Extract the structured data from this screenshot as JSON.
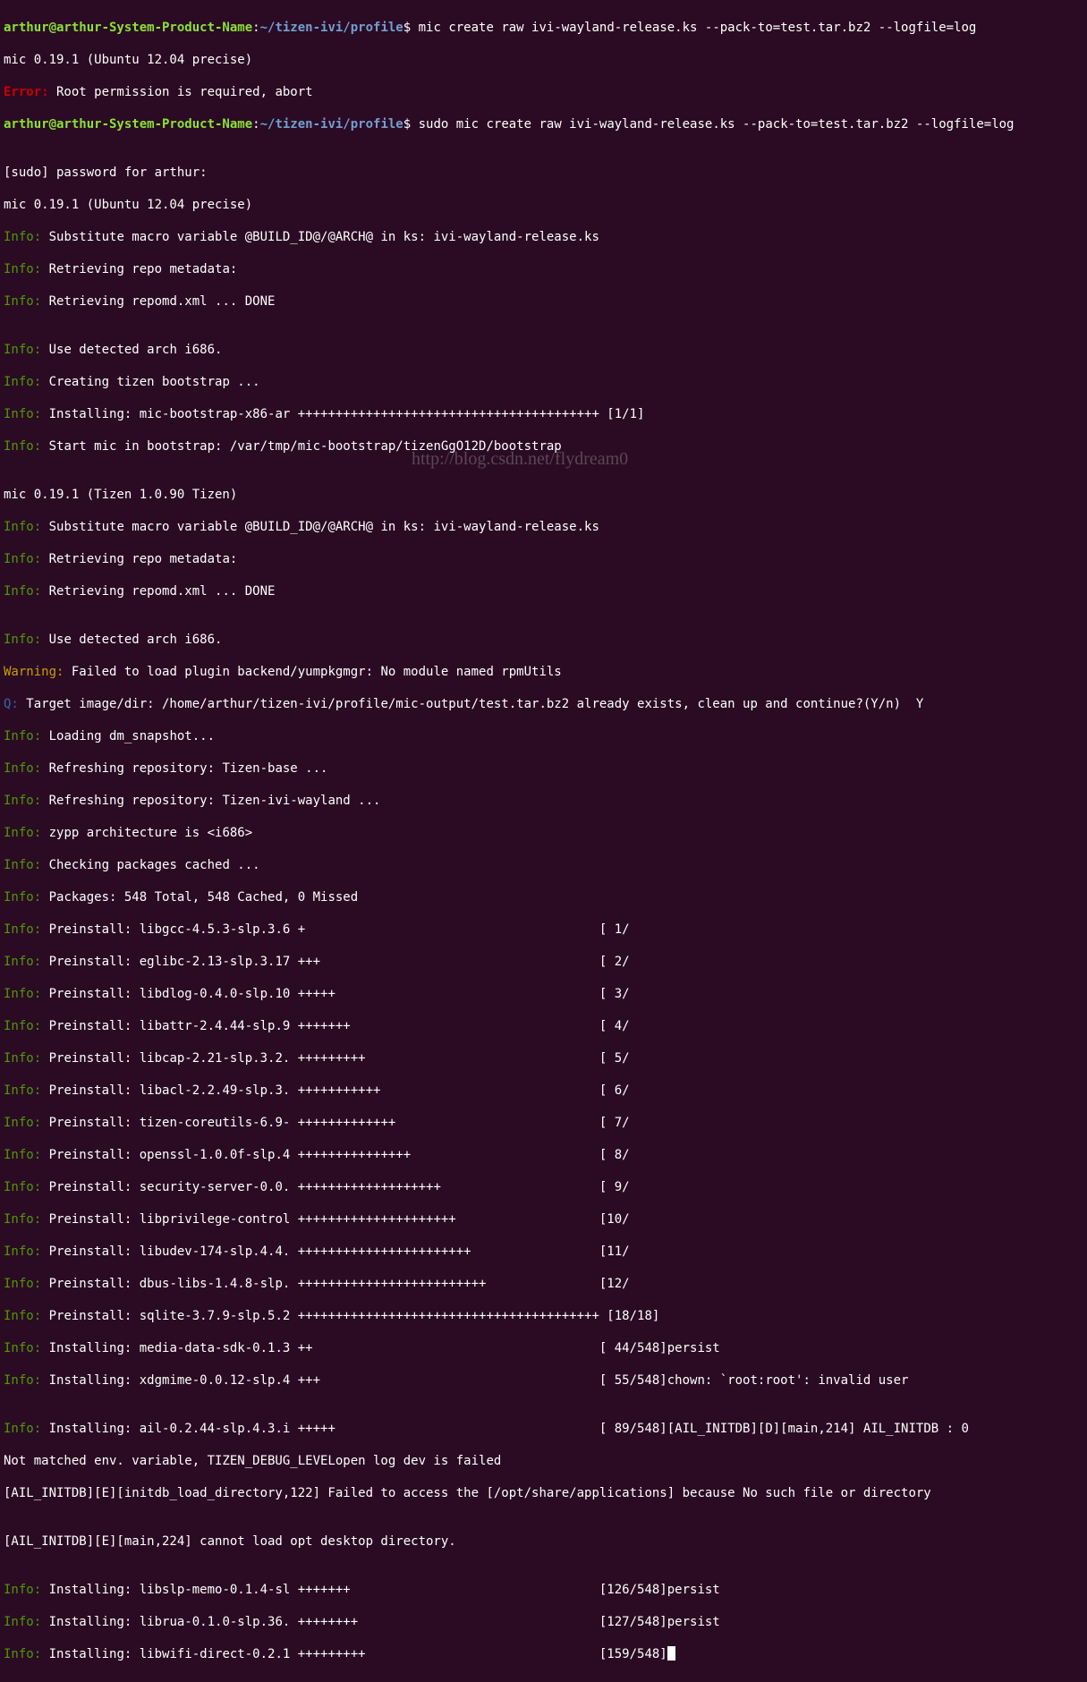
{
  "watermark": "http://blog.csdn.net/flydream0",
  "prompt1": {
    "userhost": "arthur@arthur-System-Product-Name",
    "colon": ":",
    "path": "~/tizen-ivi/profile",
    "dollar": "$ ",
    "cmd": "mic create raw ivi-wayland-release.ks --pack-to=test.tar.bz2 --logfile=log"
  },
  "line2": "mic 0.19.1 (Ubuntu 12.04 precise)",
  "line3": {
    "label": "Error:",
    "text": " Root permission is required, abort"
  },
  "prompt2": {
    "userhost": "arthur@arthur-System-Product-Name",
    "colon": ":",
    "path": "~/tizen-ivi/profile",
    "dollar": "$ ",
    "cmd": "sudo mic create raw ivi-wayland-release.ks --pack-to=test.tar.bz2 --logfile=log"
  },
  "blank1": "",
  "line5": "[sudo] password for arthur: ",
  "line6": "mic 0.19.1 (Ubuntu 12.04 precise)",
  "i1": {
    "label": "Info:",
    "text": " Substitute macro variable @BUILD_ID@/@ARCH@ in ks: ivi-wayland-release.ks"
  },
  "i2": {
    "label": "Info:",
    "text": " Retrieving repo metadata:"
  },
  "i3": {
    "label": "Info:",
    "text": " Retrieving repomd.xml ... DONE"
  },
  "blank2": "",
  "i4": {
    "label": "Info:",
    "text": " Use detected arch i686."
  },
  "i5": {
    "label": "Info:",
    "text": " Creating tizen bootstrap ..."
  },
  "i6": {
    "label": "Info:",
    "text": " Installing: mic-bootstrap-x86-ar ++++++++++++++++++++++++++++++++++++++++ [1/1]"
  },
  "i7": {
    "label": "Info:",
    "text": " Start mic in bootstrap: /var/tmp/mic-bootstrap/tizenGgO12D/bootstrap"
  },
  "blank3": "",
  "line_mic2": "mic 0.19.1 (Tizen 1.0.90 Tizen)",
  "i8": {
    "label": "Info:",
    "text": " Substitute macro variable @BUILD_ID@/@ARCH@ in ks: ivi-wayland-release.ks"
  },
  "i9": {
    "label": "Info:",
    "text": " Retrieving repo metadata:"
  },
  "i10": {
    "label": "Info:",
    "text": " Retrieving repomd.xml ... DONE"
  },
  "blank4": "",
  "i11": {
    "label": "Info:",
    "text": " Use detected arch i686."
  },
  "w1": {
    "label": "Warning:",
    "text": " Failed to load plugin backend/yumpkgmgr: No module named rpmUtils"
  },
  "q1": {
    "label": "Q:",
    "text": " Target image/dir: /home/arthur/tizen-ivi/profile/mic-output/test.tar.bz2 already exists, clean up and continue?(Y/n)  Y"
  },
  "i12": {
    "label": "Info:",
    "text": " Loading dm_snapshot..."
  },
  "i13": {
    "label": "Info:",
    "text": " Refreshing repository: Tizen-base ..."
  },
  "i14": {
    "label": "Info:",
    "text": " Refreshing repository: Tizen-ivi-wayland ..."
  },
  "i15": {
    "label": "Info:",
    "text": " zypp architecture is <i686>"
  },
  "i16": {
    "label": "Info:",
    "text": " Checking packages cached ..."
  },
  "i17": {
    "label": "Info:",
    "text": " Packages: 548 Total, 548 Cached, 0 Missed"
  },
  "p1": {
    "label": "Info:",
    "text": " Preinstall: libgcc-4.5.3-slp.3.6 +                                       [ 1/"
  },
  "p2": {
    "label": "Info:",
    "text": " Preinstall: eglibc-2.13-slp.3.17 +++                                     [ 2/"
  },
  "p3": {
    "label": "Info:",
    "text": " Preinstall: libdlog-0.4.0-slp.10 +++++                                   [ 3/"
  },
  "p4": {
    "label": "Info:",
    "text": " Preinstall: libattr-2.4.44-slp.9 +++++++                                 [ 4/"
  },
  "p5": {
    "label": "Info:",
    "text": " Preinstall: libcap-2.21-slp.3.2. +++++++++                               [ 5/"
  },
  "p6": {
    "label": "Info:",
    "text": " Preinstall: libacl-2.2.49-slp.3. +++++++++++                             [ 6/"
  },
  "p7": {
    "label": "Info:",
    "text": " Preinstall: tizen-coreutils-6.9- +++++++++++++                           [ 7/"
  },
  "p8": {
    "label": "Info:",
    "text": " Preinstall: openssl-1.0.0f-slp.4 +++++++++++++++                         [ 8/"
  },
  "p9": {
    "label": "Info:",
    "text": " Preinstall: security-server-0.0. +++++++++++++++++++                     [ 9/"
  },
  "p10": {
    "label": "Info:",
    "text": " Preinstall: libprivilege-control +++++++++++++++++++++                   [10/"
  },
  "p11": {
    "label": "Info:",
    "text": " Preinstall: libudev-174-slp.4.4. +++++++++++++++++++++++                 [11/"
  },
  "p12": {
    "label": "Info:",
    "text": " Preinstall: dbus-libs-1.4.8-slp. +++++++++++++++++++++++++               [12/"
  },
  "p13": {
    "label": "Info:",
    "text": " Preinstall: sqlite-3.7.9-slp.5.2 ++++++++++++++++++++++++++++++++++++++++ [18/18]"
  },
  "in1": {
    "label": "Info:",
    "text": " Installing: media-data-sdk-0.1.3 ++                                      [ 44/548]persist"
  },
  "in2": {
    "label": "Info:",
    "text": " Installing: xdgmime-0.0.12-slp.4 +++                                     [ 55/548]chown: `root:root': invalid user"
  },
  "blank5": "",
  "in3": {
    "label": "Info:",
    "text": " Installing: ail-0.2.44-slp.4.3.i +++++                                   [ 89/548][AIL_INITDB][D][main,214] AIL_INITDB : 0"
  },
  "line_notmatch": "Not matched env. variable, TIZEN_DEBUG_LEVELopen log dev is failed",
  "line_ail1": "[AIL_INITDB][E][initdb_load_directory,122] Failed to access the [/opt/share/applications] because No such file or directory",
  "blank6": "",
  "line_ail2": "[AIL_INITDB][E][main,224] cannot load opt desktop directory.",
  "blank7": "",
  "in4": {
    "label": "Info:",
    "text": " Installing: libslp-memo-0.1.4-sl +++++++                                 [126/548]persist"
  },
  "in5": {
    "label": "Info:",
    "text": " Installing: librua-0.1.0-slp.36. ++++++++                                [127/548]persist"
  },
  "in6": {
    "label": "Info:",
    "text": " Installing: libwifi-direct-0.2.1 +++++++++                               [159/548]"
  }
}
